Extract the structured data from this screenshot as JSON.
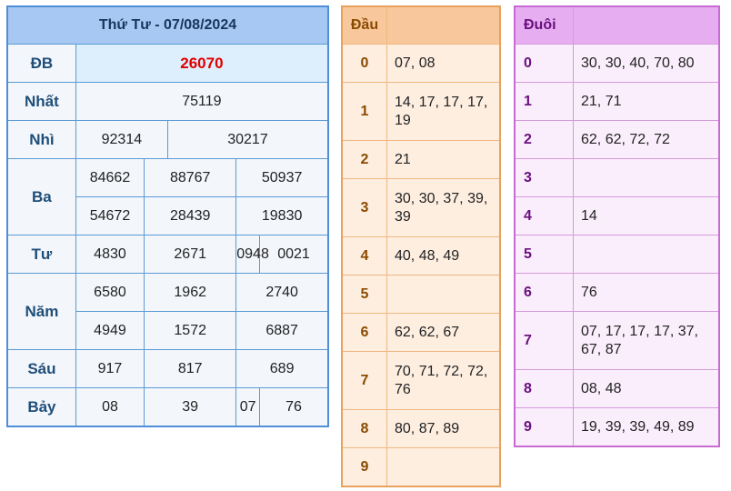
{
  "results": {
    "title": "Thứ Tư - 07/08/2024",
    "db_label": "ĐB",
    "db": "26070",
    "nhat_label": "Nhất",
    "nhat": "75119",
    "nhi_label": "Nhì",
    "nhi": [
      "92314",
      "30217"
    ],
    "ba_label": "Ba",
    "ba": [
      "84662",
      "88767",
      "50937",
      "54672",
      "28439",
      "19830"
    ],
    "tu_label": "Tư",
    "tu": [
      "4830",
      "2671",
      "0948",
      "0021"
    ],
    "nam_label": "Năm",
    "nam": [
      "6580",
      "1962",
      "2740",
      "4949",
      "1572",
      "6887"
    ],
    "sau_label": "Sáu",
    "sau": [
      "917",
      "817",
      "689"
    ],
    "bay_label": "Bảy",
    "bay": [
      "08",
      "39",
      "07",
      "76"
    ]
  },
  "dau": {
    "header": "Đầu",
    "rows": [
      {
        "k": "0",
        "v": "07, 08"
      },
      {
        "k": "1",
        "v": "14, 17, 17, 17, 19"
      },
      {
        "k": "2",
        "v": "21"
      },
      {
        "k": "3",
        "v": "30, 30, 37, 39, 39"
      },
      {
        "k": "4",
        "v": "40, 48, 49"
      },
      {
        "k": "5",
        "v": ""
      },
      {
        "k": "6",
        "v": "62, 62, 67"
      },
      {
        "k": "7",
        "v": "70, 71, 72, 72, 76"
      },
      {
        "k": "8",
        "v": "80, 87, 89"
      },
      {
        "k": "9",
        "v": ""
      }
    ]
  },
  "duoi": {
    "header": "Đuôi",
    "rows": [
      {
        "k": "0",
        "v": "30, 30, 40, 70, 80"
      },
      {
        "k": "1",
        "v": "21, 71"
      },
      {
        "k": "2",
        "v": "62, 62, 72, 72"
      },
      {
        "k": "3",
        "v": ""
      },
      {
        "k": "4",
        "v": "14"
      },
      {
        "k": "5",
        "v": ""
      },
      {
        "k": "6",
        "v": "76"
      },
      {
        "k": "7",
        "v": "07, 17, 17, 17, 37, 67, 87"
      },
      {
        "k": "8",
        "v": "08, 48"
      },
      {
        "k": "9",
        "v": "19, 39, 39, 49, 89"
      }
    ]
  }
}
